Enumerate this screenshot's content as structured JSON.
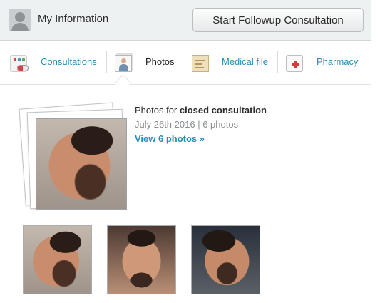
{
  "header": {
    "title": "My Information",
    "followup_button": "Start Followup Consultation"
  },
  "tabs": [
    {
      "label": "Consultations",
      "icon": "consultations-icon",
      "active": false
    },
    {
      "label": "Photos",
      "icon": "photos-icon",
      "active": true
    },
    {
      "label": "Medical file",
      "icon": "medical-file-icon",
      "active": false
    },
    {
      "label": "Pharmacy",
      "icon": "pharmacy-icon",
      "active": false
    }
  ],
  "photos": {
    "title_prefix": "Photos for",
    "title_strong": "closed consultation",
    "date": "July 26th 2016",
    "separator": "|",
    "count": "6 photos",
    "view_link": "View 6 photos »",
    "thumbnails": [
      "photo-1",
      "photo-2",
      "photo-3"
    ]
  },
  "colors": {
    "link": "#2a8db0",
    "header_bg": "#eef1f2",
    "muted_text": "#8a8e91"
  }
}
